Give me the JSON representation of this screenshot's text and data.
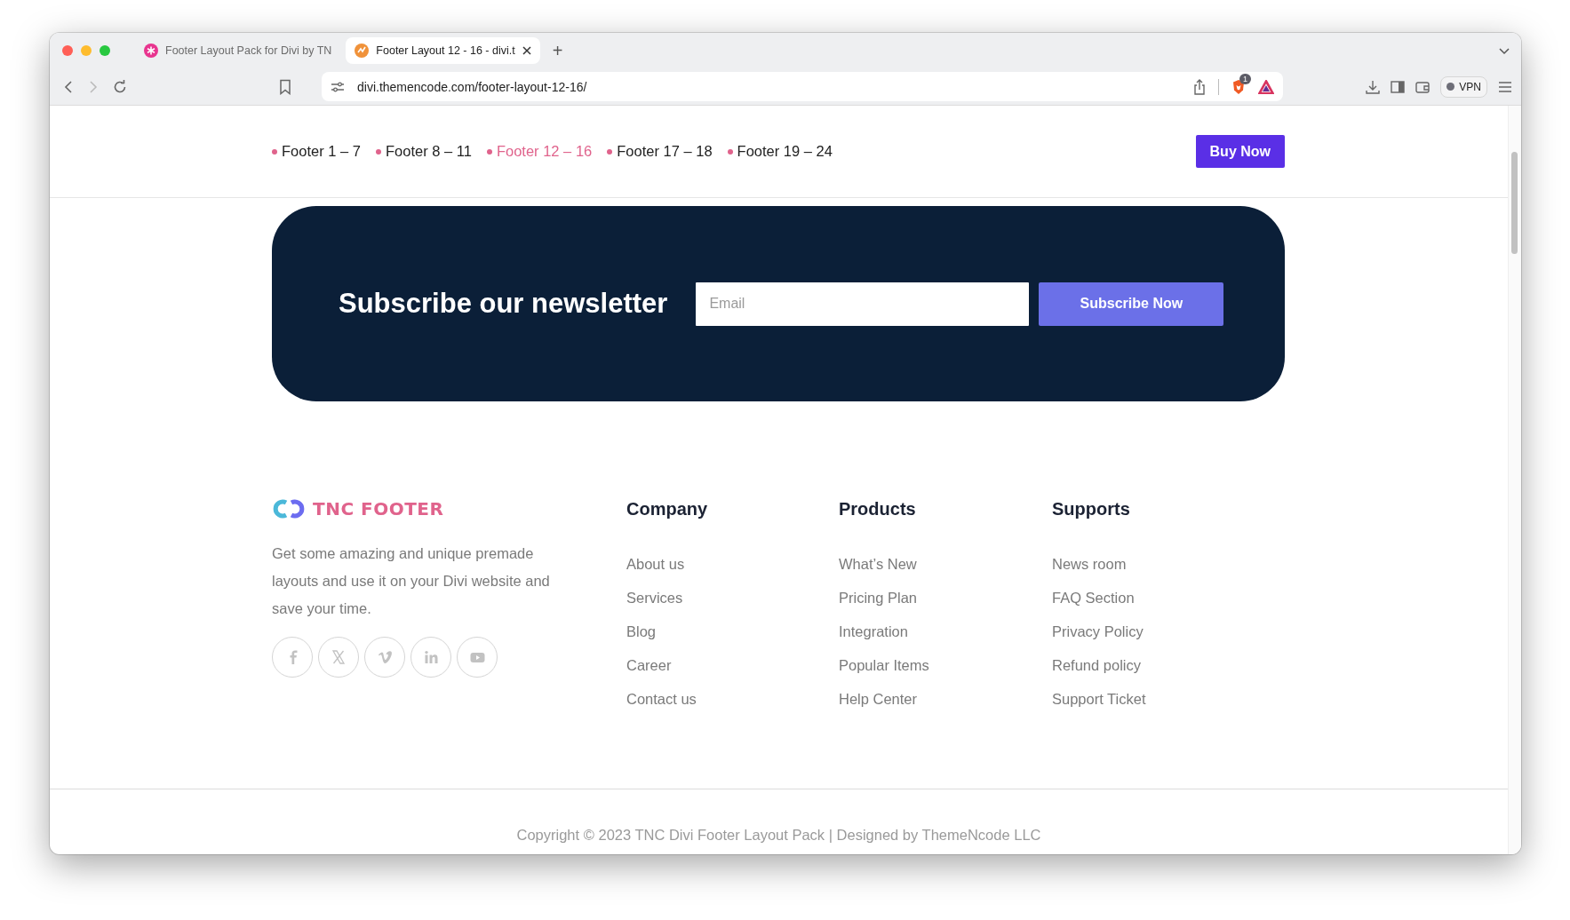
{
  "browser": {
    "tabs": [
      {
        "title": "Footer Layout Pack for Divi by TN",
        "selected": false
      },
      {
        "title": "Footer Layout 12 - 16 - divi.t",
        "selected": true
      }
    ],
    "new_tab": "+",
    "address": "divi.themencode.com/footer-layout-12-16/",
    "shield_badge": "1",
    "vpn": "VPN"
  },
  "nav": {
    "items": [
      {
        "label": "Footer 1 – 7",
        "selected": false
      },
      {
        "label": "Footer 8 – 11",
        "selected": false
      },
      {
        "label": "Footer 12 – 16",
        "selected": true
      },
      {
        "label": "Footer 17 – 18",
        "selected": false
      },
      {
        "label": "Footer 19 – 24",
        "selected": false
      }
    ],
    "button": "Buy Now"
  },
  "newsletter": {
    "title": "Subscribe our newsletter",
    "placeholder": "Email",
    "button": "Subscribe Now"
  },
  "footer": {
    "logo": "TNC FOOTER",
    "description": "Get some amazing and unique premade layouts and use it on your Divi website and save your time.",
    "socials": [
      {
        "kind": "facebook"
      },
      {
        "kind": "x"
      },
      {
        "kind": "vimeo"
      },
      {
        "kind": "linkedin"
      },
      {
        "kind": "youtube"
      }
    ],
    "columns": [
      {
        "heading": "Company",
        "links": [
          "About us",
          "Services",
          "Blog",
          "Career",
          "Contact us"
        ]
      },
      {
        "heading": "Products",
        "links": [
          "What’s New",
          "Pricing Plan",
          "Integration",
          "Popular Items",
          "Help Center"
        ]
      },
      {
        "heading": "Supports",
        "links": [
          "News room",
          "FAQ Section",
          "Privacy Policy",
          "Refund policy",
          "Support Ticket"
        ]
      }
    ]
  },
  "copyright": "Copyright © 2023 TNC Divi Footer Layout Pack | Designed by ThemeNcode LLC"
}
